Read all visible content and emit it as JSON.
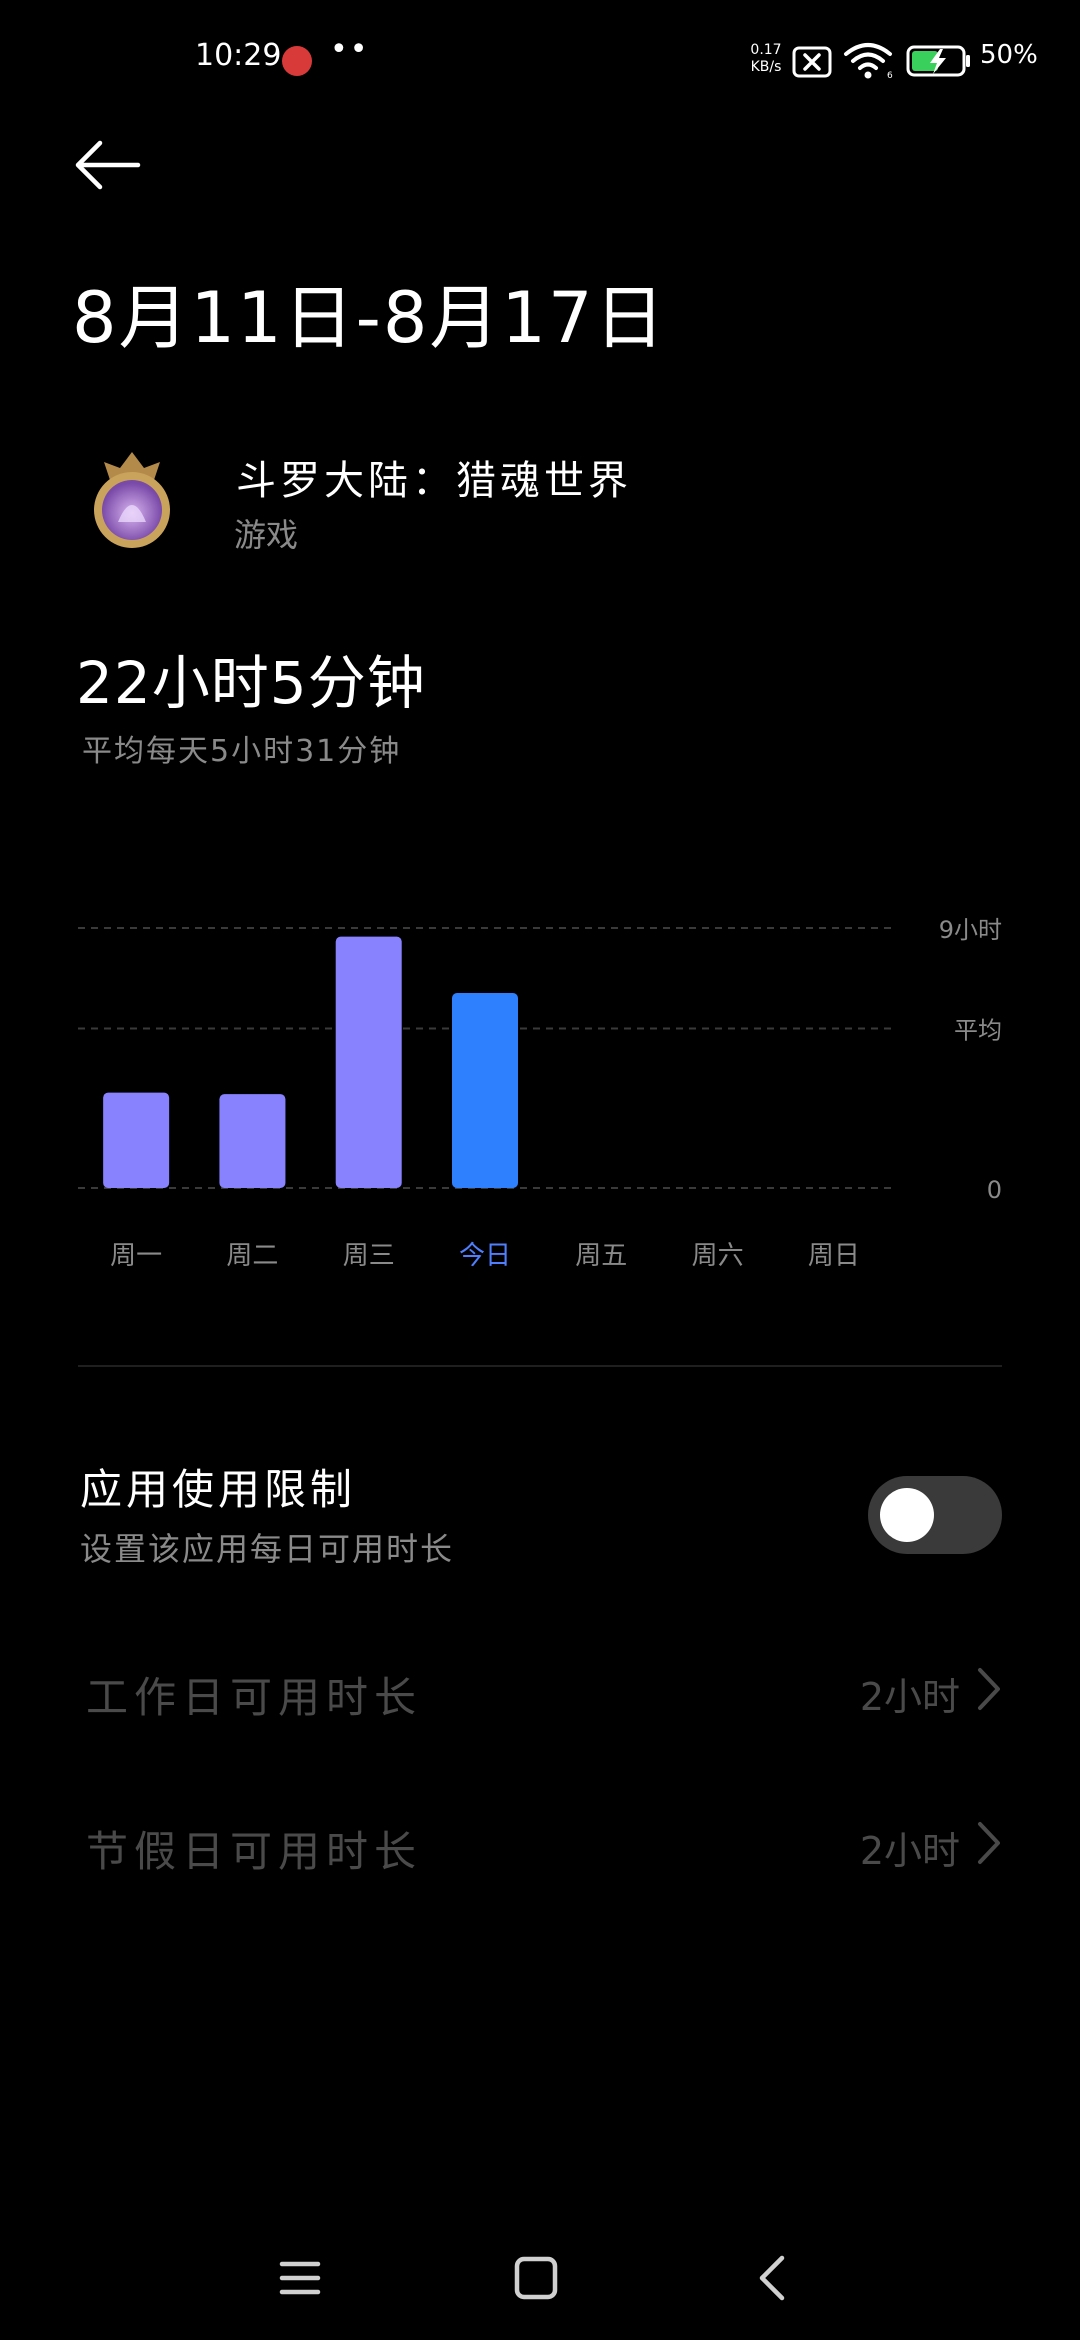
{
  "status_bar": {
    "time": "10:29",
    "dots": "••",
    "net_speed_value": "0.17",
    "net_speed_unit": "KB/s",
    "battery_percent": "50%",
    "icons": [
      "app-notification-icon",
      "sim-disabled-icon",
      "wifi-icon",
      "battery-charging-icon"
    ]
  },
  "header": {
    "title": "8月11日-8月17日",
    "back_icon": "back-arrow-icon"
  },
  "app": {
    "name": "斗罗大陆：猎魂世界",
    "category": "游戏",
    "icon": "game-app-icon"
  },
  "summary": {
    "total": "22小时5分钟",
    "average": "平均每天5小时31分钟"
  },
  "chart_data": {
    "type": "bar",
    "categories": [
      "周一",
      "周二",
      "周三",
      "今日",
      "周五",
      "周六",
      "周日"
    ],
    "values_hours": [
      3.3,
      3.25,
      8.7,
      6.75,
      null,
      null,
      null
    ],
    "highlight_index": 3,
    "ylim_hours": [
      0,
      9
    ],
    "y_labels": [
      {
        "text": "9小时",
        "value": 9
      },
      {
        "text": "平均",
        "value": 5.52
      },
      {
        "text": "0",
        "value": 0
      }
    ],
    "grid": "dashed",
    "colors": {
      "bar": "#8882ff",
      "bar_highlight": "#2f80ff",
      "label": "#8a8a8a",
      "label_highlight": "#4f7fff",
      "grid": "#3a3a3a"
    }
  },
  "limit": {
    "title": "应用使用限制",
    "description": "设置该应用每日可用时长",
    "enabled": false
  },
  "settings": {
    "weekday_label": "工作日可用时长",
    "weekday_value": "2小时",
    "holiday_label": "节假日可用时长",
    "holiday_value": "2小时"
  },
  "nav_bar": {
    "icons": [
      "menu-icon",
      "home-icon",
      "back-icon"
    ]
  }
}
